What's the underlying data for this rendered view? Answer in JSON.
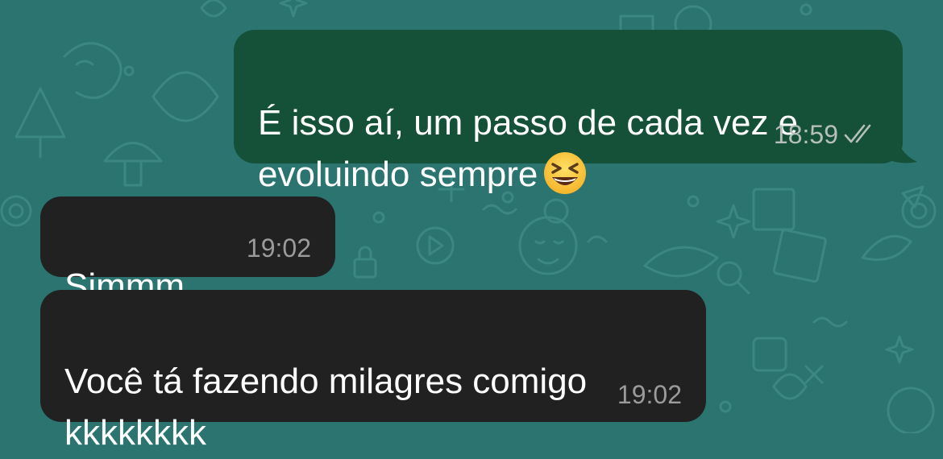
{
  "chat": {
    "messages": [
      {
        "direction": "outgoing",
        "text": "É isso aí, um passo de cada vez e\nevoluindo sempre",
        "emoji": "grinning-squinting-face",
        "time": "18:59",
        "status": "read-double-check"
      },
      {
        "direction": "incoming",
        "text": "Simmm",
        "time": "19:02"
      },
      {
        "direction": "incoming",
        "text": "Você tá fazendo milagres comigo\nkkkkkkkk",
        "time": "19:02"
      }
    ]
  },
  "colors": {
    "wallpaper": "#2b7470",
    "outgoing_bubble": "#155139",
    "incoming_bubble": "#212121",
    "text": "#ffffff",
    "timestamp_outgoing": "#b6bfbb",
    "timestamp_incoming": "#9b9b9b"
  }
}
